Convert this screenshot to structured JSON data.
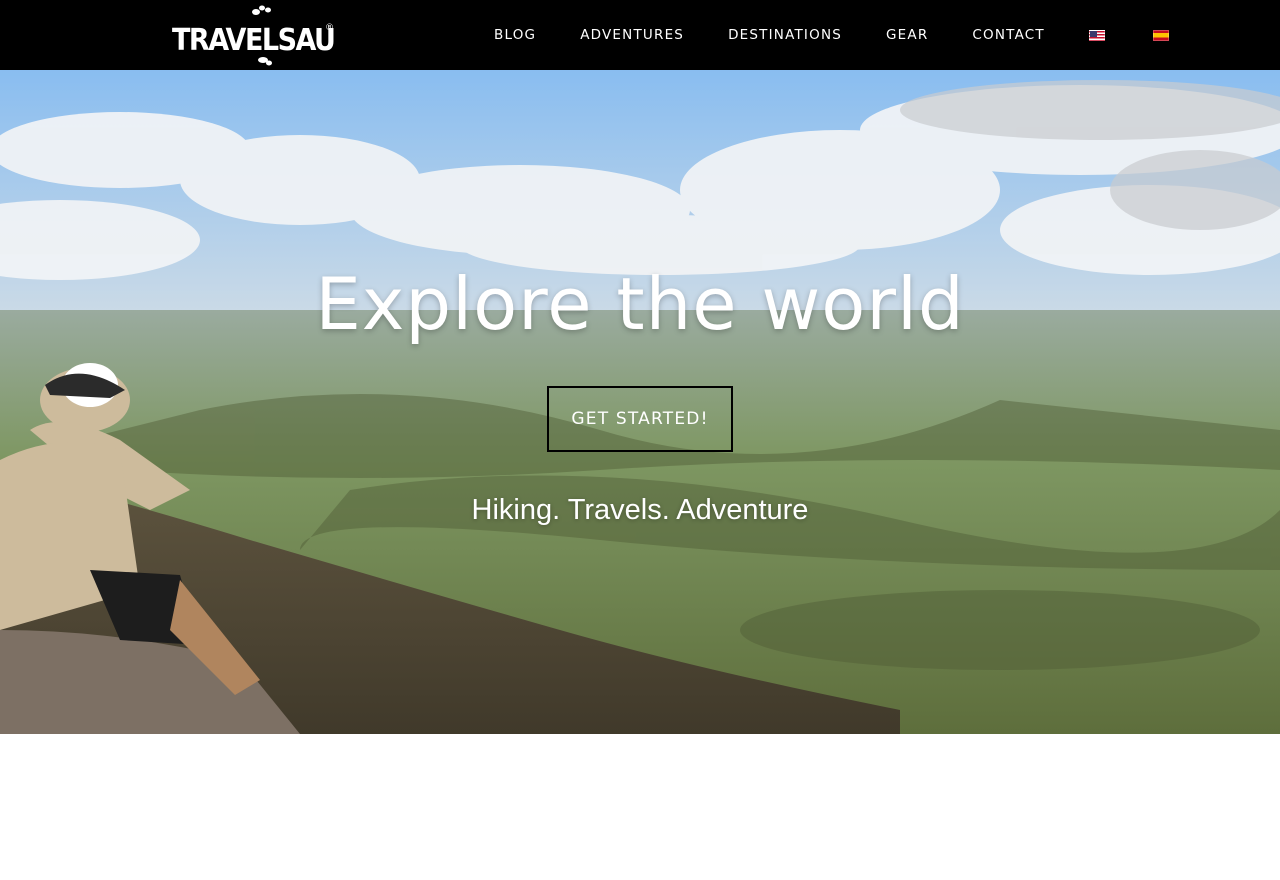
{
  "header": {
    "logo_text": "TRAVELSAURO",
    "logo_mark": "®",
    "nav": [
      {
        "label": "BLOG"
      },
      {
        "label": "ADVENTURES"
      },
      {
        "label": "DESTINATIONS"
      },
      {
        "label": "GEAR"
      },
      {
        "label": "CONTACT"
      }
    ],
    "languages": [
      {
        "icon": "us-flag-icon"
      },
      {
        "icon": "spain-flag-icon"
      }
    ]
  },
  "hero": {
    "title": "Explore the world",
    "cta_label": "GET STARTED!",
    "tagline": "Hiking. Travels. Adventure"
  },
  "colors": {
    "header_bg": "#000000",
    "text": "#ffffff",
    "cta_border": "#000000"
  }
}
